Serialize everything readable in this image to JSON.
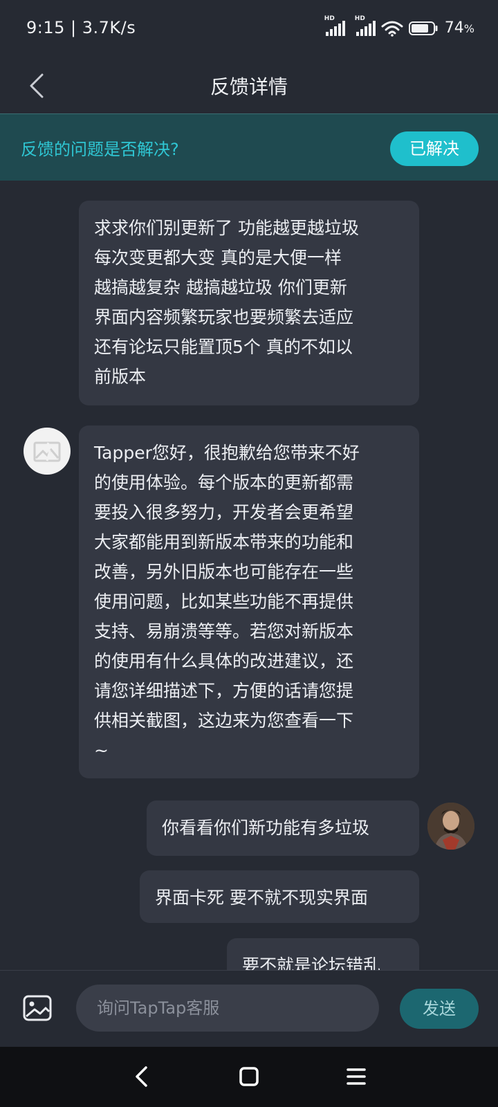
{
  "status_bar": {
    "time_speed": "9:15 | 3.7K/s",
    "battery_percent": "74",
    "battery_unit": "%",
    "signal_labels": [
      "HD",
      "HD"
    ],
    "icons": [
      "signal-icon",
      "signal-icon",
      "wifi-icon",
      "battery-icon"
    ]
  },
  "header": {
    "title": "反馈详情",
    "back_icon": "chevron-left-icon"
  },
  "resolve_banner": {
    "question": "反馈的问题是否解决?",
    "button_label": "已解决"
  },
  "messages": [
    {
      "sender": "user",
      "text": "求求你们别更新了 功能越更越垃圾\n每次变更都大变 真的是大便一样\n越搞越复杂 越搞越垃圾 你们更新\n界面内容频繁玩家也要频繁去适应\n还有论坛只能置顶5个 真的不如以\n前版本"
    },
    {
      "sender": "support",
      "text": "Tapper您好，很抱歉给您带来不好\n的使用体验。每个版本的更新都需\n要投入很多努力，开发者会更希望\n大家都能用到新版本带来的功能和\n改善，另外旧版本也可能存在一些\n使用问题，比如某些功能不再提供\n支持、易崩溃等等。若您对新版本\n的使用有什么具体的改进建议，还\n请您详细描述下，方便的话请您提\n供相关截图，这边来为您查看一下\n~"
    },
    {
      "sender": "user",
      "text": "你看看你们新功能有多垃圾"
    },
    {
      "sender": "user",
      "text": "界面卡死 要不就不现实界面"
    },
    {
      "sender": "user",
      "text": "要不就是论坛错乱"
    }
  ],
  "composer": {
    "placeholder": "询问TapTap客服",
    "send_label": "发送",
    "image_icon": "image-icon"
  },
  "nav_bar": {
    "icons": [
      "back-icon",
      "home-icon",
      "menu-icon"
    ]
  },
  "colors": {
    "background": "#262a33",
    "bubble": "#343843",
    "accent": "#1fbfcc",
    "banner": "#1f4a50"
  }
}
